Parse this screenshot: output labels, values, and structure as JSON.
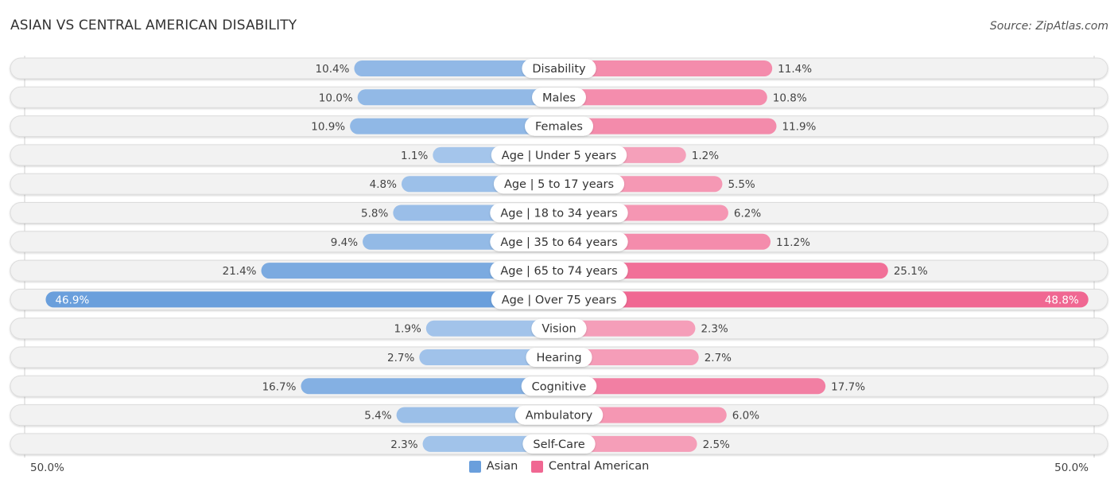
{
  "header": {
    "title": "ASIAN VS CENTRAL AMERICAN DISABILITY",
    "source": "Source: ZipAtlas.com"
  },
  "colors": {
    "asian": "#6a9fdc",
    "asian_light": "#a9c8ec",
    "central_american": "#f06792",
    "central_american_light": "#f6a6be",
    "row_bg": "#f2f2f2"
  },
  "legend": {
    "items": [
      {
        "label": "Asian",
        "color": "#6a9fdc"
      },
      {
        "label": "Central American",
        "color": "#f06792"
      }
    ]
  },
  "axis": {
    "left_label": "50.0%",
    "right_label": "50.0%"
  },
  "chart_data": {
    "type": "bar",
    "orientation": "horizontal-diverging",
    "title": "ASIAN VS CENTRAL AMERICAN DISABILITY",
    "xlim": [
      -50,
      50
    ],
    "categories": [
      "Disability",
      "Males",
      "Females",
      "Age | Under 5 years",
      "Age | 5 to 17 years",
      "Age | 18 to 34 years",
      "Age | 35 to 64 years",
      "Age | 65 to 74 years",
      "Age | Over 75 years",
      "Vision",
      "Hearing",
      "Cognitive",
      "Ambulatory",
      "Self-Care"
    ],
    "series": [
      {
        "name": "Asian",
        "side": "left",
        "values": [
          10.4,
          10.0,
          10.9,
          1.1,
          4.8,
          5.8,
          9.4,
          21.4,
          46.9,
          1.9,
          2.7,
          16.7,
          5.4,
          2.3
        ],
        "labels": [
          "10.4%",
          "10.0%",
          "10.9%",
          "1.1%",
          "4.8%",
          "5.8%",
          "9.4%",
          "21.4%",
          "46.9%",
          "1.9%",
          "2.7%",
          "16.7%",
          "5.4%",
          "2.3%"
        ]
      },
      {
        "name": "Central American",
        "side": "right",
        "values": [
          11.4,
          10.8,
          11.9,
          1.2,
          5.5,
          6.2,
          11.2,
          25.1,
          48.8,
          2.3,
          2.7,
          17.7,
          6.0,
          2.5
        ],
        "labels": [
          "11.4%",
          "10.8%",
          "11.9%",
          "1.2%",
          "5.5%",
          "6.2%",
          "11.2%",
          "25.1%",
          "48.8%",
          "2.3%",
          "2.7%",
          "17.7%",
          "6.0%",
          "2.5%"
        ]
      }
    ],
    "axis_tick_labels": [
      "50.0%",
      "50.0%"
    ],
    "legend_position": "bottom-center",
    "grid": false
  }
}
